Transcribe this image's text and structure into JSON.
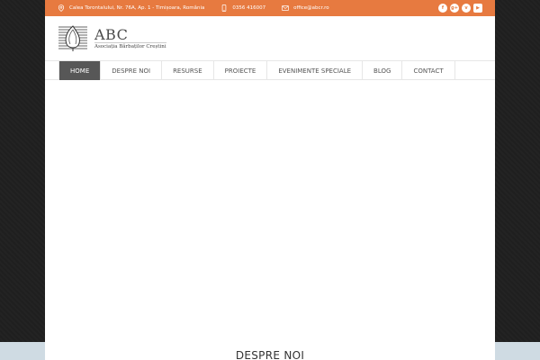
{
  "topbar": {
    "address": "Calea Torontalului, Nr. 76A, Ap. 1 - Timișoara, România",
    "phone": "0356 416007",
    "email": "office@abcr.ro",
    "background_color": "#e77a40",
    "icons": {
      "address": "map-pin-icon",
      "phone": "phone-icon",
      "email": "mail-icon"
    },
    "socials": [
      {
        "name": "facebook-icon",
        "glyph": "f"
      },
      {
        "name": "google-plus-icon",
        "glyph": "g+"
      },
      {
        "name": "vimeo-icon",
        "glyph": "v"
      },
      {
        "name": "youtube-icon",
        "glyph": "▶"
      }
    ]
  },
  "logo": {
    "title": "ABC",
    "subtitle": "Asociația Bărbaților Creștini",
    "icon": "leaf-logo-icon"
  },
  "nav": {
    "items": [
      {
        "label": "HOME",
        "active": true
      },
      {
        "label": "DESPRE NOI",
        "active": false
      },
      {
        "label": "RESURSE",
        "active": false
      },
      {
        "label": "PROIECTE",
        "active": false
      },
      {
        "label": "EVENIMENTE SPECIALE",
        "active": false
      },
      {
        "label": "BLOG",
        "active": false
      },
      {
        "label": "CONTACT",
        "active": false
      }
    ],
    "active_color": "#575757"
  },
  "main": {
    "section_title": "DESPRE NOI"
  }
}
